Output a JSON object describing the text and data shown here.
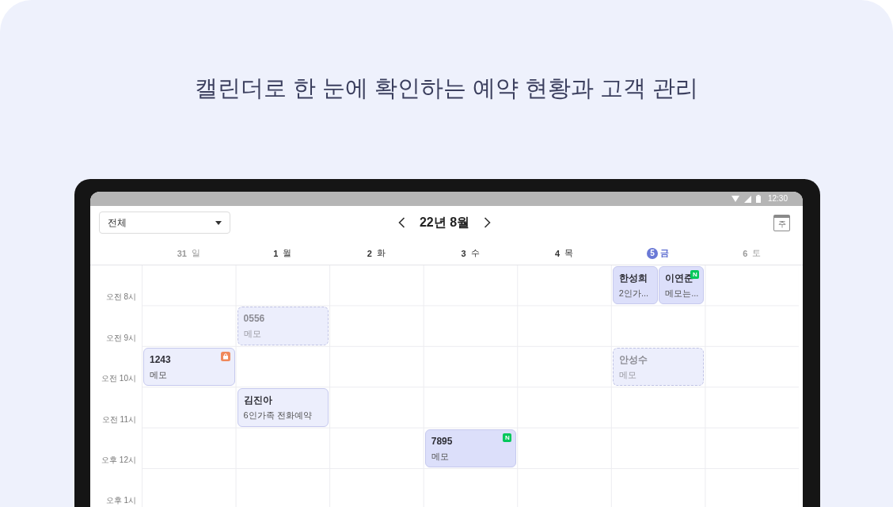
{
  "headline": "캘린더로 한 눈에 확인하는 예약 현황과 고객 관리",
  "status_bar": {
    "time": "12:30"
  },
  "toolbar": {
    "filter": {
      "value": "전체"
    },
    "month": "22년 8월",
    "view_button": {
      "label": "주"
    }
  },
  "days": [
    {
      "date": "31",
      "weekday": "일",
      "muted": true,
      "today": false
    },
    {
      "date": "1",
      "weekday": "월",
      "muted": false,
      "today": false
    },
    {
      "date": "2",
      "weekday": "화",
      "muted": false,
      "today": false
    },
    {
      "date": "3",
      "weekday": "수",
      "muted": false,
      "today": false
    },
    {
      "date": "4",
      "weekday": "목",
      "muted": false,
      "today": false
    },
    {
      "date": "5",
      "weekday": "금",
      "muted": false,
      "today": true
    },
    {
      "date": "6",
      "weekday": "토",
      "muted": true,
      "today": false
    }
  ],
  "rows": [
    {
      "time": "오전 8시",
      "cells": [
        null,
        null,
        null,
        null,
        null,
        [
          {
            "name": "한성희",
            "memo": "2인가...",
            "kind": "confirmed",
            "color": "#dcdffa"
          },
          {
            "name": "이연준",
            "memo": "메모는...",
            "kind": "confirmed",
            "color": "#dcdffa",
            "badge": {
              "kind": "letter",
              "text": "N"
            }
          }
        ],
        null
      ]
    },
    {
      "time": "오전 9시",
      "cells": [
        null,
        [
          {
            "name": "0556",
            "memo": "메모",
            "kind": "pending",
            "color": "#eceefc"
          }
        ],
        null,
        null,
        null,
        null,
        null
      ]
    },
    {
      "time": "오전 10시",
      "cells": [
        [
          {
            "name": "1243",
            "memo": "메모",
            "kind": "confirmed",
            "color": "#eceefc",
            "badge": {
              "kind": "lock"
            }
          }
        ],
        null,
        null,
        null,
        null,
        [
          {
            "name": "안성수",
            "memo": "메모",
            "kind": "pending",
            "color": "#eceefc"
          }
        ],
        null
      ]
    },
    {
      "time": "오전 11시",
      "cells": [
        null,
        [
          {
            "name": "김진아",
            "memo": "6인가족 전화예약",
            "kind": "confirmed",
            "color": "#eceefc"
          }
        ],
        null,
        null,
        null,
        null,
        null
      ]
    },
    {
      "time": "오후 12시",
      "cells": [
        null,
        null,
        null,
        [
          {
            "name": "7895",
            "memo": "메모",
            "kind": "confirmed",
            "color": "#dcdffa",
            "badge": {
              "kind": "letter",
              "text": "N"
            }
          }
        ],
        null,
        null,
        null
      ]
    },
    {
      "time": "오후 1시",
      "cells": [
        null,
        null,
        null,
        null,
        null,
        null,
        null
      ]
    }
  ]
}
